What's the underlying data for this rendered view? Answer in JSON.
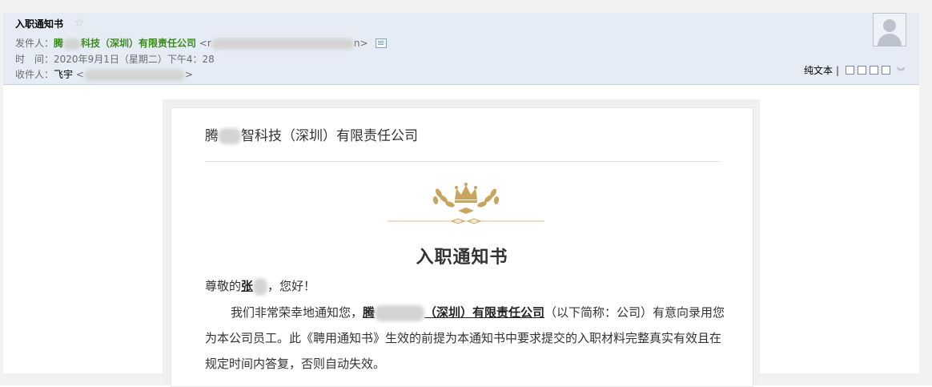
{
  "header": {
    "subject": "入职通知书",
    "sender_label": "发件人：",
    "sender_name_prefix": "腾",
    "sender_name_suffix": "科技（深圳）有限责任公司",
    "sender_addr_open": "<r",
    "sender_addr_close": "n>",
    "time_label": "时　间：",
    "time_value": "2020年9月1日（星期二）下午4：28",
    "recipient_label": "收件人：",
    "recipient_name": "飞宇",
    "recipient_addr_open": "<",
    "recipient_addr_close": ">",
    "plain_text_label": "纯文本",
    "separator": "|"
  },
  "letter": {
    "company_prefix": "腾",
    "company_suffix": "智科技（深圳）有限责任公司",
    "title": "入职通知书",
    "greeting_prefix": "尊敬的",
    "greeting_name": "张",
    "greeting_suffix": "，您好！",
    "intro": "我们非常荣幸地通知您，",
    "company_ref_prefix": "腾",
    "company_ref_suffix": "（深圳）有限责任公司",
    "intro_rest": "（以下简称：公司）有意向录用您为本公司员工。此《聘用通知书》生效的前提为本通知书中要求提交的入职材料完整真实有效且在规定时间内答复，否则自动失效。"
  },
  "colors": {
    "header_bg": "#e6ecf5",
    "sender_green": "#3a8a1a",
    "crown_gold": "#c9a45c"
  },
  "icons": [
    "star-icon",
    "contact-card-icon",
    "avatar",
    "popout-icon",
    "compose-icon",
    "save-icon",
    "print-icon",
    "chevron-down-icon",
    "crown-emblem"
  ]
}
